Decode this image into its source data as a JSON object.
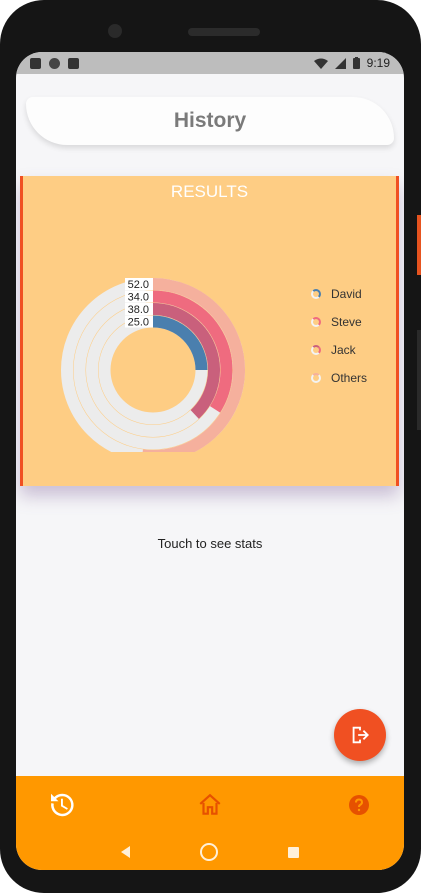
{
  "status_bar": {
    "time": "9:19",
    "left_icons": [
      "a-icon",
      "circle-icon",
      "sim-icon"
    ],
    "right_icons": [
      "wifi-icon",
      "signal-icon",
      "battery-icon"
    ]
  },
  "header": {
    "title": "History"
  },
  "card": {
    "title": "RESULTS",
    "background": "#fecd84",
    "accent": "#f05022"
  },
  "chart_data": {
    "type": "radial-bar",
    "title": "RESULTS",
    "max": 100,
    "series": [
      {
        "name": "Others",
        "value": 52.0,
        "label": "52.0",
        "color": "#f5b09d"
      },
      {
        "name": "Jack",
        "value": 34.0,
        "label": "34.0",
        "color": "#ef6b7f"
      },
      {
        "name": "Steve",
        "value": 38.0,
        "label": "38.0",
        "color": "#c9607c"
      },
      {
        "name": "David",
        "value": 25.0,
        "label": "25.0",
        "color": "#4a7fae"
      }
    ],
    "track_color": "#ececec",
    "legend": [
      "David",
      "Steve",
      "Jack",
      "Others"
    ],
    "legend_position": "right"
  },
  "legend_items": [
    {
      "label": "David",
      "color": "#4a7fae"
    },
    {
      "label": "Steve",
      "color": "#ef6b7f"
    },
    {
      "label": "Jack",
      "color": "#c9607c"
    },
    {
      "label": "Others",
      "color": "#f5b09d"
    }
  ],
  "hint": "Touch to see stats",
  "nav": {
    "items": [
      "history-icon",
      "home-icon",
      "help-icon"
    ],
    "bar_color": "#ff9800"
  },
  "fab": {
    "icon": "logout-icon",
    "color": "#f05022"
  }
}
